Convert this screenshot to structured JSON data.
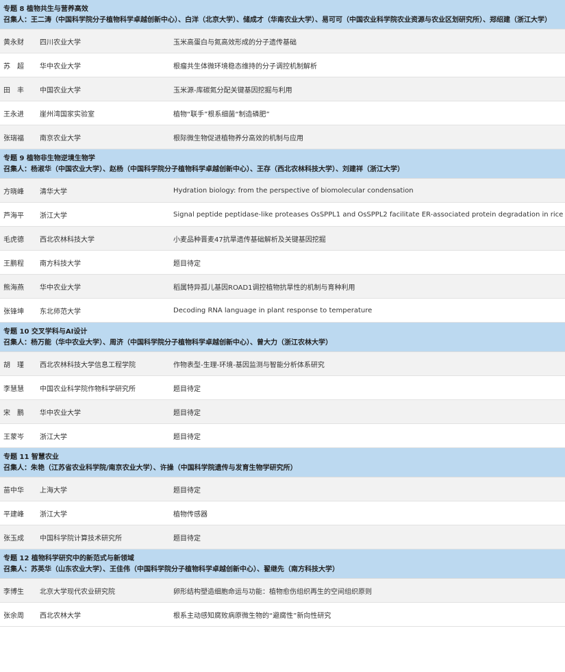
{
  "sections": [
    {
      "title": "专题 8 植物共生与营养高效",
      "conveners": "召集人：王二涛（中国科学院分子植物科学卓越创新中心）、白洋（北京大学）、储成才（华南农业大学）、易可可（中国农业科学院农业资源与农业区划研究所）、郑绍建（浙江大学）",
      "rows": [
        {
          "name": "黄永财",
          "org": "四川农业大学",
          "title": "玉米高蛋白与氮高效形成的分子遗传基础"
        },
        {
          "name": "苏　超",
          "org": "华中农业大学",
          "title": "根瘤共生体微环境稳态维持的分子调控机制解析"
        },
        {
          "name": "田　丰",
          "org": "中国农业大学",
          "title": "玉米源-库碳氮分配关键基因挖掘与利用"
        },
        {
          "name": "王永进",
          "org": "崖州湾国家实验室",
          "title": "植物“联手”根系细菌“制造磷肥”"
        },
        {
          "name": "张瑞福",
          "org": "南京农业大学",
          "title": "根际微生物促进植物养分高效的机制与应用"
        }
      ]
    },
    {
      "title": "专题 9 植物非生物逆境生物学",
      "conveners": "召集人：杨淑华（中国农业大学）、赵杨（中国科学院分子植物科学卓越创新中心）、王存（西北农林科技大学）、刘建祥（浙江大学）",
      "rows": [
        {
          "name": "方晓峰",
          "org": "清华大学",
          "title": "Hydration biology: from the perspective of biomolecular condensation"
        },
        {
          "name": "芦海平",
          "org": "浙江大学",
          "title": "Signal peptide peptidase-like proteases OsSPPL1 and OsSPPL2 facilitate ER-associated protein degradation in rice"
        },
        {
          "name": "毛虎德",
          "org": "西北农林科技大学",
          "title": "小麦品种晋麦47抗旱遗传基础解析及关键基因挖掘"
        },
        {
          "name": "王鹏程",
          "org": "南方科技大学",
          "title": "题目待定"
        },
        {
          "name": "熊海燕",
          "org": "华中农业大学",
          "title": "稻属特异孤儿基因ROAD1调控植物抗旱性的机制与育种利用"
        },
        {
          "name": "张锋坤",
          "org": "东北师范大学",
          "title": "Decoding RNA language in plant response to temperature"
        }
      ]
    },
    {
      "title": "专题 10 交叉学科与AI设计",
      "conveners": "召集人：杨万能（华中农业大学）、周济（中国科学院分子植物科学卓越创新中心）、曾大力（浙江农林大学）",
      "rows": [
        {
          "name": "胡　瑾",
          "org": "西北农林科技大学信息工程学院",
          "title": "作物表型-生理-环境-基因监测与智能分析体系研究"
        },
        {
          "name": "李慧慧",
          "org": "中国农业科学院作物科学研究所",
          "title": "题目待定"
        },
        {
          "name": "宋　鹏",
          "org": "华中农业大学",
          "title": "题目待定"
        },
        {
          "name": "王蒙岑",
          "org": "浙江大学",
          "title": "题目待定"
        }
      ]
    },
    {
      "title": "专题 11 智慧农业",
      "conveners": "召集人：朱艳（江苏省农业科学院/南京农业大学）、许操（中国科学院遗传与发育生物学研究所）",
      "rows": [
        {
          "name": "苗中华",
          "org": "上海大学",
          "title": "题目待定"
        },
        {
          "name": "平建峰",
          "org": "浙江大学",
          "title": "植物传感器"
        },
        {
          "name": "张玉成",
          "org": "中国科学院计算技术研究所",
          "title": "题目待定"
        }
      ]
    },
    {
      "title": "专题 12 植物科学研究中的新范式与新领域",
      "conveners": "召集人：苏英华（山东农业大学）、王佳伟（中国科学院分子植物科学卓越创新中心）、翟继先（南方科技大学）",
      "rows": [
        {
          "name": "李博生",
          "org": "北京大学现代农业研究院",
          "title": "卵形结构塑造细胞命运与功能：植物愈伤组织再生的空间组织原则"
        },
        {
          "name": "张余周",
          "org": "西北农林大学",
          "title": "根系主动感知腐败病原微生物的“避腐性”新向性研究"
        }
      ]
    }
  ]
}
